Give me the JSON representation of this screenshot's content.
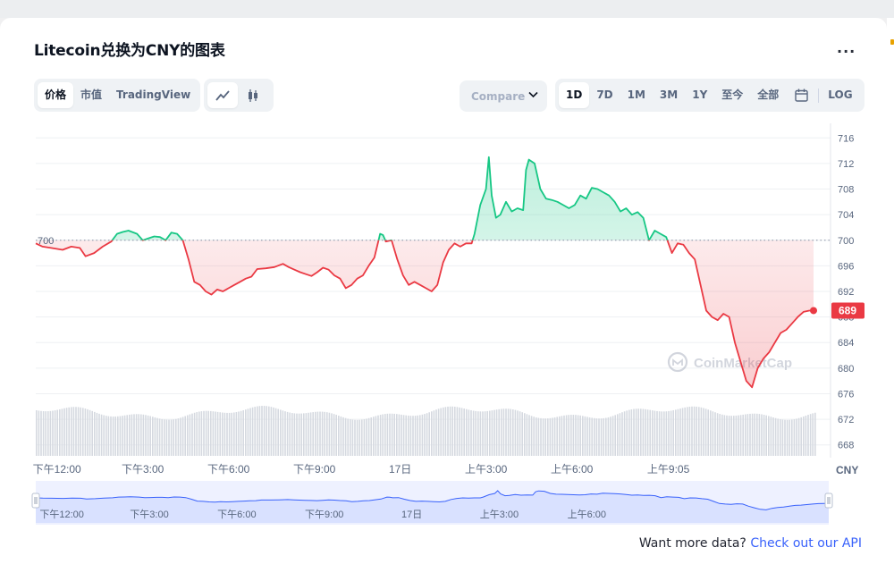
{
  "header": {
    "title": "Litecoin兑换为CNY的图表",
    "more_label": "..."
  },
  "toolbar": {
    "view_tabs": [
      "价格",
      "市值",
      "TradingView"
    ],
    "compare_label": "Compare",
    "ranges": [
      "1D",
      "7D",
      "1M",
      "3M",
      "1Y",
      "至今",
      "全部"
    ],
    "log_label": "LOG"
  },
  "footer": {
    "text": "Want more data?",
    "link": "Check out our API"
  },
  "watermark": "CoinMarketCap",
  "colors": {
    "up": "#16c784",
    "down": "#ea3943",
    "nav": "#3861fb",
    "marker": "#ea3943"
  },
  "chart_data": {
    "type": "line",
    "currency": "CNY",
    "reference_value": 700,
    "reference_label": "700",
    "current_value": 689,
    "current_label": "689",
    "ylim": [
      666,
      718
    ],
    "y_ticks": [
      "716",
      "712",
      "708",
      "704",
      "700",
      "696",
      "692",
      "688",
      "684",
      "680",
      "676",
      "672",
      "668"
    ],
    "x_ticks": [
      {
        "label": "下午12:00",
        "t": 9
      },
      {
        "label": "下午3:00",
        "t": 12
      },
      {
        "label": "下午6:00",
        "t": 15
      },
      {
        "label": "下午9:00",
        "t": 18
      },
      {
        "label": "17日",
        "t": 21
      },
      {
        "label": "上午3:00",
        "t": 24
      },
      {
        "label": "上午6:00",
        "t": 27
      },
      {
        "label": "上午9:05",
        "t": 30
      }
    ],
    "nav_ticks": [
      "下午12:00",
      "下午3:00",
      "下午6:00",
      "下午9:00",
      "17日",
      "上午3:00",
      "上午6:00"
    ],
    "series": [
      {
        "values": [
          [
            8.26,
            699.5
          ],
          [
            8.5,
            699
          ],
          [
            8.8,
            698.8
          ],
          [
            9.2,
            698.5
          ],
          [
            9.5,
            699
          ],
          [
            9.8,
            698.8
          ],
          [
            10.0,
            697.5
          ],
          [
            10.3,
            698
          ],
          [
            10.6,
            699
          ],
          [
            10.9,
            699.8
          ],
          [
            11.1,
            701
          ],
          [
            11.3,
            701.3
          ],
          [
            11.5,
            701.5
          ],
          [
            11.8,
            701
          ],
          [
            12.0,
            700
          ],
          [
            12.2,
            700.3
          ],
          [
            12.4,
            700.6
          ],
          [
            12.6,
            700.5
          ],
          [
            12.8,
            700
          ],
          [
            13.0,
            701.2
          ],
          [
            13.2,
            701
          ],
          [
            13.4,
            700
          ],
          [
            13.6,
            697
          ],
          [
            13.8,
            693.5
          ],
          [
            14.0,
            693
          ],
          [
            14.2,
            692
          ],
          [
            14.4,
            691.5
          ],
          [
            14.6,
            692.3
          ],
          [
            14.8,
            692
          ],
          [
            15.0,
            692.5
          ],
          [
            15.2,
            693
          ],
          [
            15.4,
            693.5
          ],
          [
            15.6,
            694
          ],
          [
            15.8,
            694.3
          ],
          [
            16.0,
            695.5
          ],
          [
            16.3,
            695.6
          ],
          [
            16.6,
            695.8
          ],
          [
            16.9,
            696.3
          ],
          [
            17.1,
            695.8
          ],
          [
            17.3,
            695.4
          ],
          [
            17.5,
            695
          ],
          [
            17.7,
            694.7
          ],
          [
            17.9,
            694.4
          ],
          [
            18.1,
            695
          ],
          [
            18.3,
            695.7
          ],
          [
            18.5,
            695.4
          ],
          [
            18.7,
            694.5
          ],
          [
            18.9,
            694
          ],
          [
            19.1,
            692.5
          ],
          [
            19.3,
            693
          ],
          [
            19.5,
            694
          ],
          [
            19.7,
            694.5
          ],
          [
            19.9,
            696
          ],
          [
            20.1,
            697.3
          ],
          [
            20.3,
            701
          ],
          [
            20.4,
            700.8
          ],
          [
            20.5,
            699.8
          ],
          [
            20.7,
            700
          ],
          [
            20.9,
            697
          ],
          [
            21.1,
            694.5
          ],
          [
            21.3,
            693
          ],
          [
            21.5,
            693.5
          ],
          [
            21.7,
            693
          ],
          [
            21.9,
            692.5
          ],
          [
            22.1,
            692
          ],
          [
            22.3,
            693
          ],
          [
            22.5,
            696.5
          ],
          [
            22.7,
            698.5
          ],
          [
            22.9,
            699.5
          ],
          [
            23.1,
            699
          ],
          [
            23.3,
            699.5
          ],
          [
            23.5,
            699.5
          ],
          [
            23.6,
            701
          ],
          [
            23.8,
            705.5
          ],
          [
            24.0,
            708
          ],
          [
            24.1,
            713
          ],
          [
            24.2,
            707
          ],
          [
            24.35,
            703.5
          ],
          [
            24.5,
            704
          ],
          [
            24.7,
            706
          ],
          [
            24.9,
            704.5
          ],
          [
            25.1,
            705
          ],
          [
            25.3,
            704.7
          ],
          [
            25.4,
            711
          ],
          [
            25.5,
            712.6
          ],
          [
            25.7,
            712
          ],
          [
            25.9,
            708
          ],
          [
            26.1,
            706.5
          ],
          [
            26.3,
            706.3
          ],
          [
            26.5,
            706
          ],
          [
            26.7,
            705.5
          ],
          [
            26.9,
            705
          ],
          [
            27.1,
            705.5
          ],
          [
            27.3,
            707
          ],
          [
            27.5,
            706.5
          ],
          [
            27.7,
            708.2
          ],
          [
            27.9,
            708
          ],
          [
            28.1,
            707.5
          ],
          [
            28.3,
            707
          ],
          [
            28.5,
            706
          ],
          [
            28.7,
            704.5
          ],
          [
            28.9,
            705
          ],
          [
            29.1,
            704
          ],
          [
            29.3,
            704.4
          ],
          [
            29.5,
            703.5
          ],
          [
            29.7,
            700
          ],
          [
            29.9,
            701.5
          ],
          [
            30.1,
            701
          ],
          [
            30.3,
            700.5
          ],
          [
            30.5,
            698
          ],
          [
            30.7,
            699.5
          ],
          [
            30.9,
            699.3
          ],
          [
            31.1,
            698
          ],
          [
            31.3,
            697
          ],
          [
            31.5,
            693
          ],
          [
            31.7,
            689
          ],
          [
            31.9,
            688
          ],
          [
            32.1,
            687.5
          ],
          [
            32.3,
            688.5
          ],
          [
            32.5,
            688
          ],
          [
            32.7,
            684
          ],
          [
            32.9,
            681
          ],
          [
            33.1,
            678
          ],
          [
            33.3,
            677
          ],
          [
            33.5,
            680
          ],
          [
            33.7,
            681.5
          ],
          [
            33.9,
            682.5
          ],
          [
            34.1,
            684
          ],
          [
            34.3,
            685.5
          ],
          [
            34.5,
            686
          ],
          [
            34.7,
            687
          ],
          [
            34.9,
            688
          ],
          [
            35.1,
            688.8
          ],
          [
            35.3,
            689
          ],
          [
            35.45,
            689
          ]
        ]
      }
    ]
  }
}
